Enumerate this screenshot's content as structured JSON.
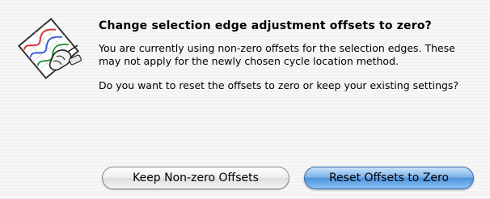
{
  "dialog": {
    "title": "Change selection edge adjustment offsets to zero?",
    "message_1": "You are currently using non-zero offsets for the selection edges.  These may not apply for the newly chosen cycle location method.",
    "message_2": "Do you want to reset the offsets to zero or keep your existing settings?",
    "icon": "graph-paper-hand-icon",
    "buttons": {
      "keep_label": "Keep Non-zero Offsets",
      "reset_label": "Reset Offsets to Zero"
    },
    "colors": {
      "default_button": "#4f93dd",
      "background": "#f4f4f4"
    }
  }
}
